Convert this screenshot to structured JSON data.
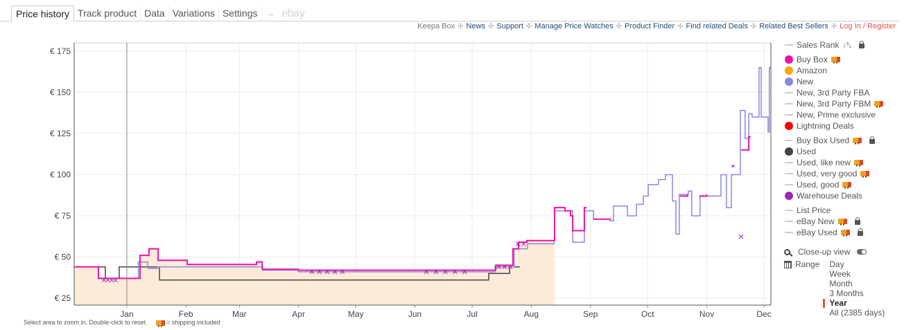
{
  "tabs": [
    "Price history",
    "Track product",
    "Data",
    "Variations",
    "Settings"
  ],
  "tab_arrow": "→",
  "tab_ebay": "ebay",
  "links": {
    "keepa_box": "Keepa Box",
    "items": [
      "News",
      "Support",
      "Manage Price Watches",
      "Product Finder",
      "Find related Deals",
      "Related Best Sellers"
    ],
    "login": "Log In / Register"
  },
  "legend": [
    {
      "label": "Sales Rank",
      "type": "dash",
      "sort": "↓⁹₁",
      "lock": true
    },
    {
      "label": "Buy Box",
      "type": "dot",
      "color": "#f00fa8",
      "truck": true,
      "gap": true
    },
    {
      "label": "Amazon",
      "type": "dot",
      "color": "#ffa500"
    },
    {
      "label": "New",
      "type": "dot",
      "color": "#8888dd"
    },
    {
      "label": "New, 3rd Party FBA",
      "type": "dash"
    },
    {
      "label": "New, 3rd Party FBM",
      "type": "dash",
      "truck": true
    },
    {
      "label": "New, Prime exclusive",
      "type": "dash"
    },
    {
      "label": "Lightning Deals",
      "type": "dot",
      "color": "#ff0000"
    },
    {
      "label": "Buy Box Used",
      "type": "dash",
      "truck": true,
      "lock": true,
      "gap": true
    },
    {
      "label": "Used",
      "type": "dot",
      "color": "#444444"
    },
    {
      "label": "Used, like new",
      "type": "dash",
      "truck": true
    },
    {
      "label": "Used, very good",
      "type": "dash",
      "truck": true
    },
    {
      "label": "Used, good",
      "type": "dash",
      "truck": true
    },
    {
      "label": "Warehouse Deals",
      "type": "dot",
      "color": "#9c27b0"
    },
    {
      "label": "List Price",
      "type": "dash",
      "gap": true
    },
    {
      "label": "eBay New",
      "type": "dash",
      "truck": true,
      "lock": true
    },
    {
      "label": "eBay Used",
      "type": "dash",
      "truck": true,
      "lock": true
    }
  ],
  "tools": {
    "closeup_label": "Close-up view",
    "range_label": "Range",
    "range_options": [
      "Day",
      "Week",
      "Month",
      "3 Months",
      "Year",
      "All (2385 days)"
    ],
    "range_selected": "Year"
  },
  "hint": {
    "zoom": "Select area to zoom in. Double-click to reset.",
    "shipping": "= shipping included"
  },
  "chart_data": {
    "type": "line",
    "title": "",
    "xlabel": "",
    "ylabel": "",
    "x_unit": "days since Jan 1",
    "xlim": [
      -27.6,
      337.6
    ],
    "ylim": [
      20.8,
      180
    ],
    "y_ticks": [
      25,
      50,
      75,
      100,
      125,
      150,
      175
    ],
    "y_tick_labels": [
      "€ 25",
      "€ 50",
      "€ 75",
      "€ 100",
      "€ 125",
      "€ 150",
      "€ 175"
    ],
    "x_ticks": [
      0,
      31,
      59,
      90,
      120,
      151,
      181,
      212,
      243,
      273,
      304,
      334
    ],
    "x_tick_labels": [
      "Jan",
      "Feb",
      "Mar",
      "Apr",
      "May",
      "Jun",
      "Jul",
      "Aug",
      "Sep",
      "Oct",
      "Nov",
      "Dec"
    ],
    "grid": true,
    "marker_day": 0,
    "shaded_until_day": 224.2,
    "series": [
      {
        "name": "Used",
        "color": "#444444",
        "step": true,
        "points": [
          [
            -27.6,
            44
          ],
          [
            -11.3,
            44
          ],
          [
            -11.3,
            37
          ],
          [
            -4,
            37
          ],
          [
            -4,
            44
          ],
          [
            17.1,
            44
          ],
          [
            17.1,
            36
          ],
          [
            189.7,
            36
          ],
          [
            189.7,
            40
          ],
          [
            200.6,
            40
          ],
          [
            200.6,
            44
          ],
          [
            206,
            44
          ]
        ]
      },
      {
        "name": "New",
        "color": "#8888dd",
        "step": true,
        "points": [
          [
            -27.6,
            44
          ],
          [
            -14.9,
            37
          ],
          [
            5.1,
            37
          ],
          [
            6,
            47
          ],
          [
            11,
            43
          ],
          [
            16,
            44
          ],
          [
            57,
            44
          ],
          [
            68,
            44
          ],
          [
            71,
            42
          ],
          [
            90,
            41
          ],
          [
            190,
            41
          ],
          [
            193,
            44
          ],
          [
            203,
            55
          ],
          [
            210,
            58
          ],
          [
            224,
            60
          ],
          [
            224.2,
            78
          ],
          [
            229.7,
            78
          ],
          [
            233.7,
            59
          ],
          [
            238.7,
            59
          ],
          [
            239.8,
            78
          ],
          [
            244.6,
            73
          ],
          [
            253.3,
            72
          ],
          [
            255.1,
            81
          ],
          [
            262.4,
            75
          ],
          [
            267.1,
            82
          ],
          [
            270.7,
            87
          ],
          [
            273.3,
            94
          ],
          [
            278.7,
            97
          ],
          [
            282.3,
            100
          ],
          [
            286,
            84
          ],
          [
            287.8,
            64
          ],
          [
            289.6,
            88
          ],
          [
            294.3,
            90
          ],
          [
            296.1,
            75
          ],
          [
            300.5,
            87
          ],
          [
            311.4,
            100
          ],
          [
            314.3,
            80
          ],
          [
            316.9,
            100
          ],
          [
            319.4,
            100
          ],
          [
            321.6,
            139
          ],
          [
            324.1,
            122
          ],
          [
            326,
            137
          ],
          [
            327.8,
            135
          ],
          [
            331.4,
            165
          ],
          [
            332.5,
            135
          ],
          [
            336.1,
            126
          ],
          [
            336.8,
            165
          ],
          [
            337.6,
            165
          ]
        ]
      },
      {
        "name": "Buy Box",
        "color": "#f00fa8",
        "step": true,
        "points": [
          [
            -27.6,
            44
          ],
          [
            -14.9,
            37
          ],
          [
            5.1,
            37
          ],
          [
            6.9,
            51
          ],
          [
            11.6,
            55
          ],
          [
            16.4,
            48
          ],
          [
            31.6,
            45.5
          ],
          [
            68,
            47
          ],
          [
            71,
            42.5
          ],
          [
            90,
            42
          ],
          [
            191.5,
            42
          ],
          [
            193.3,
            45
          ],
          [
            202.4,
            55
          ],
          [
            205.3,
            59
          ],
          [
            209.7,
            60
          ],
          [
            224.2,
            80
          ],
          [
            229.7,
            78
          ],
          [
            232.6,
            75
          ],
          [
            233.7,
            66
          ],
          [
            238.7,
            66
          ],
          [
            239.8,
            80
          ],
          [
            241,
            80
          ],
          null,
          [
            244.6,
            73
          ],
          [
            253.3,
            72.5
          ],
          null,
          [
            290,
            87
          ],
          [
            294,
            88
          ],
          null,
          [
            300,
            87
          ],
          [
            304,
            88
          ],
          null,
          [
            317,
            105
          ],
          [
            318,
            106
          ],
          null,
          [
            322,
            115
          ],
          [
            326,
            123
          ],
          [
            327,
            123
          ]
        ]
      }
    ],
    "warehouse_deals": [
      [
        -12,
        36
      ],
      [
        -10,
        36
      ],
      [
        -8,
        36
      ],
      [
        -6,
        36
      ],
      [
        97,
        41
      ],
      [
        101,
        41
      ],
      [
        105,
        41
      ],
      [
        109,
        41
      ],
      [
        113,
        41
      ],
      [
        157,
        41
      ],
      [
        162,
        41
      ],
      [
        167,
        41
      ],
      [
        172,
        41
      ],
      [
        177,
        41
      ],
      [
        195,
        44
      ],
      [
        198,
        44
      ],
      [
        201,
        44
      ],
      [
        205,
        58
      ],
      [
        208,
        58
      ],
      [
        322,
        62.4
      ]
    ]
  }
}
